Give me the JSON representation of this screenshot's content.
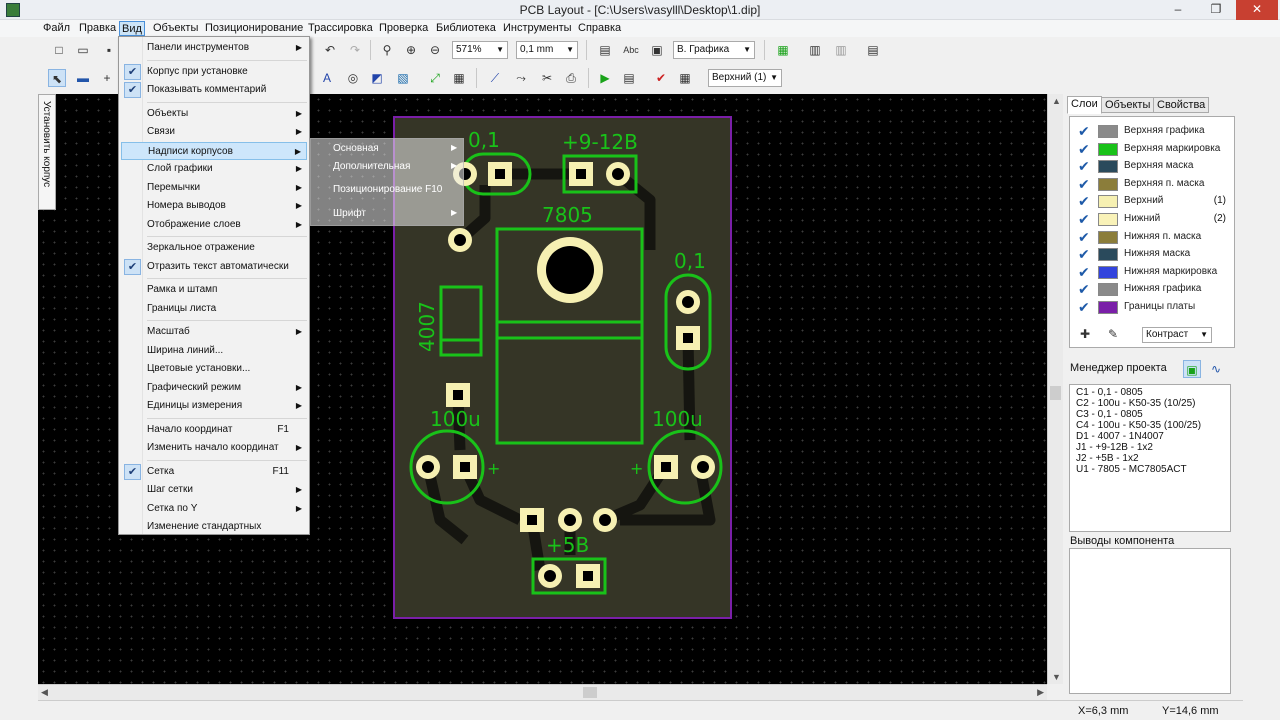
{
  "window": {
    "title": "PCB Layout - [C:\\Users\\vasylll\\Desktop\\1.dip]",
    "minimize": "–",
    "maximize": "❐",
    "close": "✕"
  },
  "menubar": [
    "Файл",
    "Правка",
    "Вид",
    "Объекты",
    "Позиционирование",
    "Трассировка",
    "Проверка",
    "Библиотека",
    "Инструменты",
    "Справка"
  ],
  "toolbar": {
    "zoom": "571%",
    "grid": "0,1 mm",
    "graphics_layer": "В. Графика",
    "layer": "Верхний (1)"
  },
  "left_tab": "Установить корпус",
  "view_menu": [
    {
      "label": "Панели инструментов",
      "sub": true
    },
    {
      "sep": true
    },
    {
      "label": "Корпус при установке",
      "checked": true
    },
    {
      "label": "Показывать комментарий",
      "checked": true
    },
    {
      "sep": true
    },
    {
      "label": "Объекты",
      "sub": true
    },
    {
      "label": "Связи",
      "sub": true
    },
    {
      "label": "Надписи корпусов",
      "sub": true,
      "highlight": true
    },
    {
      "label": "Слой графики",
      "sub": true
    },
    {
      "label": "Перемычки",
      "sub": true
    },
    {
      "label": "Номера выводов",
      "sub": true
    },
    {
      "label": "Отображение слоев",
      "sub": true
    },
    {
      "sep": true
    },
    {
      "label": "Зеркальное отражение"
    },
    {
      "label": "Отразить текст автоматически",
      "checked": true
    },
    {
      "sep": true
    },
    {
      "label": "Рамка и штамп"
    },
    {
      "label": "Границы листа"
    },
    {
      "sep": true
    },
    {
      "label": "Масштаб",
      "sub": true
    },
    {
      "label": "Ширина линий..."
    },
    {
      "label": "Цветовые установки..."
    },
    {
      "label": "Графический режим",
      "sub": true
    },
    {
      "label": "Единицы измерения",
      "sub": true
    },
    {
      "sep": true
    },
    {
      "label": "Начало координат",
      "shortcut": "F1"
    },
    {
      "label": "Изменить начало координат",
      "sub": true
    },
    {
      "sep": true
    },
    {
      "label": "Сетка",
      "shortcut": "F11",
      "checked": true
    },
    {
      "label": "Шаг сетки",
      "sub": true
    },
    {
      "label": "Сетка по Y",
      "sub": true
    },
    {
      "label": "Изменение стандартных"
    }
  ],
  "submenu": [
    {
      "label": "Основная",
      "sub": true
    },
    {
      "label": "Дополнительная",
      "sub": true
    },
    {
      "label": "Позиционирование F10"
    },
    {
      "label": "Шрифт",
      "sub": true
    }
  ],
  "board_labels": {
    "c1": "0,1",
    "j1": "+9-12В",
    "u1": "7805",
    "c3": "0,1",
    "d1": "4007",
    "c2": "100u",
    "c4": "100u",
    "j2": "+5В",
    "plus_left": "+",
    "plus_right": "+"
  },
  "colors": {
    "canvas": "#000000",
    "board": "#353526",
    "board_outline": "#7a1fa8",
    "silk": "#19c219",
    "pad": "#f6f0b2",
    "trace": "#151510"
  },
  "right_panel": {
    "tabs": [
      "Слои",
      "Объекты",
      "Свойства"
    ],
    "layers": [
      {
        "name": "Верхняя графика",
        "color": "#8a8a8a",
        "suffix": ""
      },
      {
        "name": "Верхняя маркировка",
        "color": "#19c219",
        "suffix": ""
      },
      {
        "name": "Верхняя маска",
        "color": "#2a4a5c",
        "suffix": ""
      },
      {
        "name": "Верхняя п. маска",
        "color": "#8b7d3a",
        "suffix": ""
      },
      {
        "name": "Верхний",
        "color": "#f6f0b2",
        "suffix": "(1)"
      },
      {
        "name": "Нижний",
        "color": "#f9f2b8",
        "suffix": "(2)"
      },
      {
        "name": "Нижняя п. маска",
        "color": "#8b7d3a",
        "suffix": ""
      },
      {
        "name": "Нижняя маска",
        "color": "#2a4a5c",
        "suffix": ""
      },
      {
        "name": "Нижняя маркировка",
        "color": "#3344dd",
        "suffix": ""
      },
      {
        "name": "Нижняя графика",
        "color": "#8a8a8a",
        "suffix": ""
      },
      {
        "name": "Границы платы",
        "color": "#7a1fa8",
        "suffix": ""
      }
    ],
    "contrast": "Контраст",
    "project_manager_title": "Менеджер проекта",
    "project_items": [
      "C1 - 0,1 - 0805",
      "C2 - 100u - K50-35 (10/25)",
      "C3 - 0,1 - 0805",
      "C4 - 100u - K50-35 (100/25)",
      "D1 - 4007 - 1N4007",
      "J1 - +9-12В - 1x2",
      "J2 - +5В - 1x2",
      "U1 - 7805 - MC7805ACT"
    ],
    "pins_title": "Выводы компонента"
  },
  "status": {
    "x": "X=6,3 mm",
    "y": "Y=14,6 mm"
  }
}
